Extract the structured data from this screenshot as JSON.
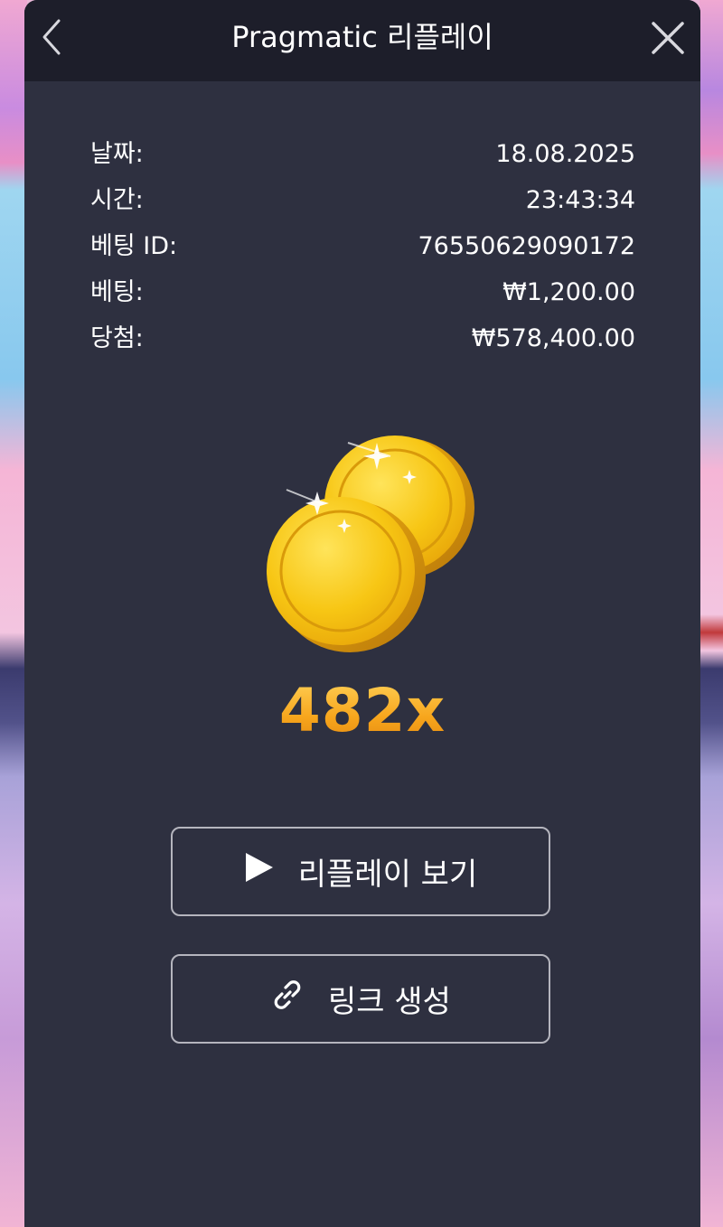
{
  "header": {
    "title": "Pragmatic 리플레이",
    "back_icon": "chevron-left-icon",
    "close_icon": "close-icon"
  },
  "info": {
    "date_label": "날짜:",
    "date_value": "18.08.2025",
    "time_label": "시간:",
    "time_value": "23:43:34",
    "bet_id_label": "베팅 ID:",
    "bet_id_value": "76550629090172",
    "bet_label": "베팅:",
    "bet_value": "₩1,200.00",
    "win_label": "당첨:",
    "win_value": "₩578,400.00"
  },
  "result": {
    "icon": "coins-icon",
    "multiplier": "482x"
  },
  "actions": {
    "replay_label": "리플레이 보기",
    "replay_icon": "play-icon",
    "link_label": "링크 생성",
    "link_icon": "link-icon"
  },
  "colors": {
    "modal_bg": "#2e3040",
    "header_bg": "#1d1e2a",
    "accent_gold": "#f5b020",
    "button_border": "#b5b5be"
  }
}
